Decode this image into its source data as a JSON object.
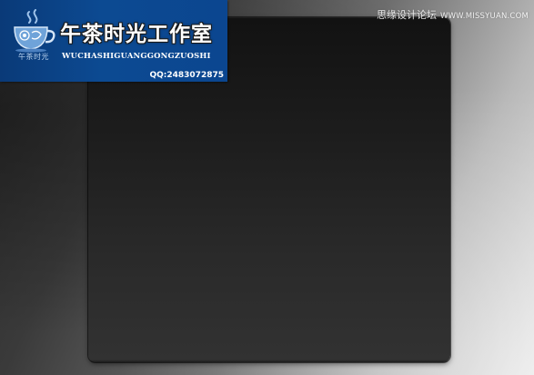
{
  "watermark": {
    "brand_cn": "午茶时光工作室",
    "brand_pinyin": "WUCHASHIGUANGGONGZUOSHI",
    "qq": "QQ:2483072875",
    "logo_caption": "午茶时光",
    "banner_color": "#0c4a92"
  },
  "site": {
    "name": "思缘设计论坛",
    "url": "WWW.MISSYUAN.COM"
  },
  "canvas": {
    "panel_color": "#1d1d1d",
    "background_color": "#6e6e6e"
  }
}
